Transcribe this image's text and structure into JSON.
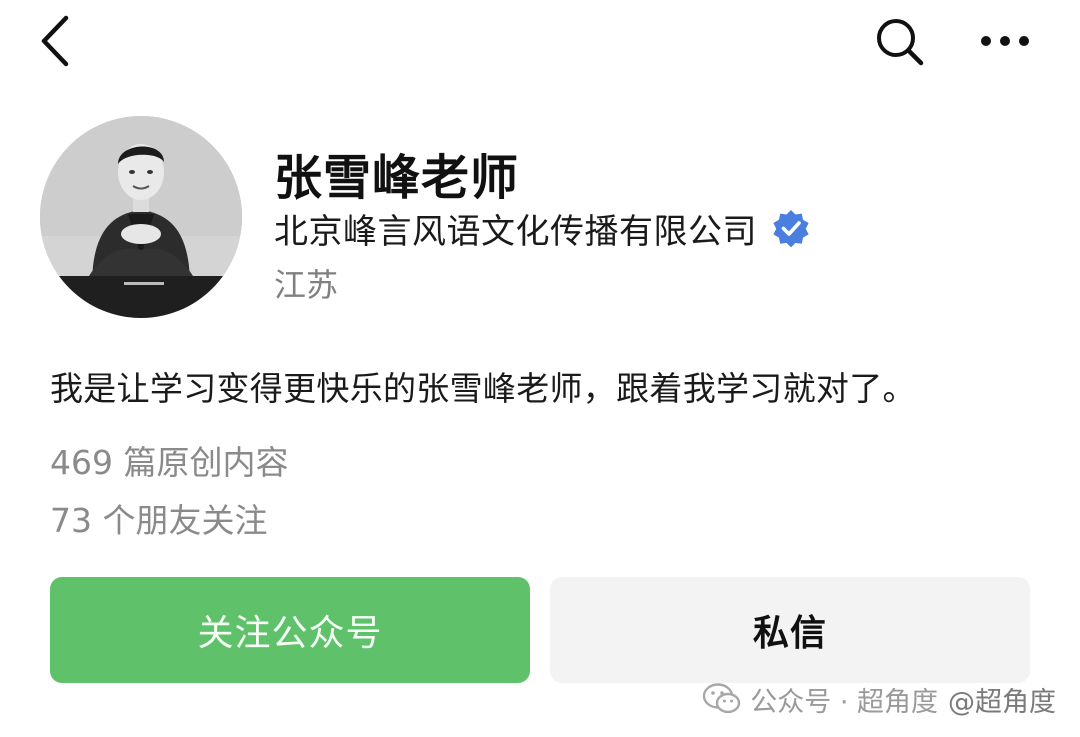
{
  "nav": {
    "back_icon": "chevron-left-icon",
    "search_icon": "search-icon",
    "more_icon": "more-horizontal-icon"
  },
  "profile": {
    "name": "张雪峰老师",
    "organization": "北京峰言风语文化传播有限公司",
    "verified_icon": "verified-badge-icon",
    "region": "江苏",
    "bio": "我是让学习变得更快乐的张雪峰老师，跟着我学习就对了。",
    "original_content": "469 篇原创内容",
    "friends_following": "73 个朋友关注"
  },
  "actions": {
    "follow_label": "关注公众号",
    "message_label": "私信"
  },
  "watermark": {
    "source": "公众号 · 超角度",
    "handle": "@超角度"
  },
  "colors": {
    "follow_button": "#5fc26b",
    "message_button": "#f3f3f3",
    "verified_badge": "#4a7fe0",
    "secondary_text": "#8a8a8a"
  }
}
